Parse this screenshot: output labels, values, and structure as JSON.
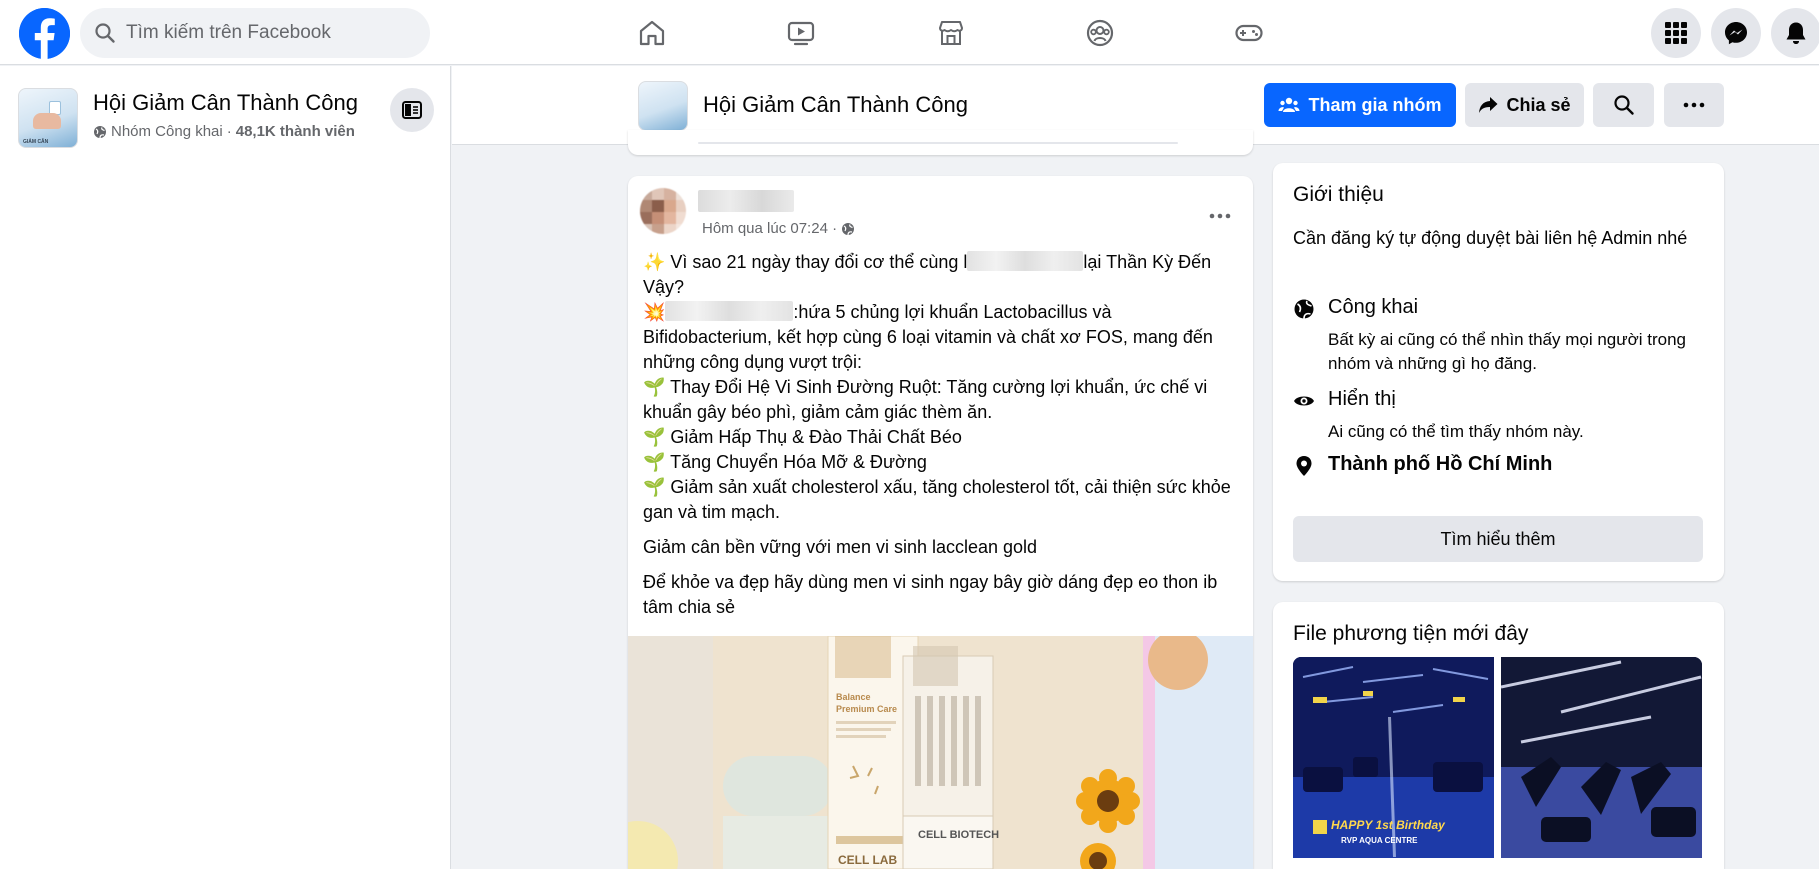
{
  "topbar": {
    "search_placeholder": "Tìm kiếm trên Facebook",
    "nav_tabs": [
      "home-tab",
      "video-tab",
      "marketplace-tab",
      "groups-tab",
      "gaming-tab"
    ],
    "right_buttons": [
      "menu-icon",
      "messenger-icon",
      "notifications-icon"
    ]
  },
  "left_panel": {
    "group_name": "Hội Giảm Cân Thành Công",
    "privacy": "Nhóm Công khai",
    "separator": "·",
    "member_count": "48,1K thành viên"
  },
  "group_header": {
    "title": "Hội Giảm Cân Thành Công",
    "join_label": "Tham gia nhóm",
    "share_label": "Chia sẻ"
  },
  "post": {
    "timestamp": "Hôm qua lúc 07:24 ·",
    "line1_start": "✨ Vì sao 21 ngày thay đổi cơ thể cùng l",
    "line1_end": "lại Thần Kỳ Đến Vậy?",
    "line2_start": "💥",
    "line2_end": ":hứa 5 chủng lợi khuẩn Lactobacillus và Bifidobacterium, kết hợp cùng 6 loại vitamin và chất xơ FOS, mang đến những công dụng vượt trội:",
    "bullets": [
      "🌱 Thay Đổi Hệ Vi Sinh Đường Ruột: Tăng cường lợi khuẩn, ức chế vi khuẩn gây béo phì, giảm cảm giác thèm ăn.",
      "🌱 Giảm Hấp Thụ & Đào Thải Chất Béo",
      "🌱 Tăng Chuyển Hóa Mỡ & Đường",
      "🌱 Giảm sản xuất cholesterol xấu, tăng cholesterol tốt, cải thiện sức khỏe gan và tim mạch."
    ],
    "para2": "Giảm cân bền vững với men vi sinh lacclean gold",
    "para3": "Để khỏe va đẹp hãy dùng men vi sinh ngay bây giờ dáng đẹp eo thon ib tâm chia sẻ",
    "image_text": {
      "box_brand": "Balance",
      "box_sub": "Premium Care",
      "brand": "CELL BIOTECH",
      "box_bottom": "CELL LAB"
    }
  },
  "about": {
    "heading": "Giới thiệu",
    "description": "Cần đăng ký tự động duyệt bài liên hệ Admin nhé",
    "public_title": "Công khai",
    "public_desc": "Bất kỳ ai cũng có thể nhìn thấy mọi người trong nhóm và những gì họ đăng.",
    "visible_title": "Hiển thị",
    "visible_desc": "Ai cũng có thể tìm thấy nhóm này.",
    "location": "Thành phố Hồ Chí Minh",
    "learn_more": "Tìm hiểu thêm"
  },
  "media": {
    "heading": "File phương tiện mới đây",
    "thumb1_caption": "HAPPY 1st Birthday",
    "thumb1_sub": "RVP AQUA CENTRE"
  },
  "colors": {
    "brand_blue": "#0866ff",
    "background": "#f0f2f5",
    "button_gray": "#e4e6eb",
    "secondary_text": "#65676b"
  }
}
